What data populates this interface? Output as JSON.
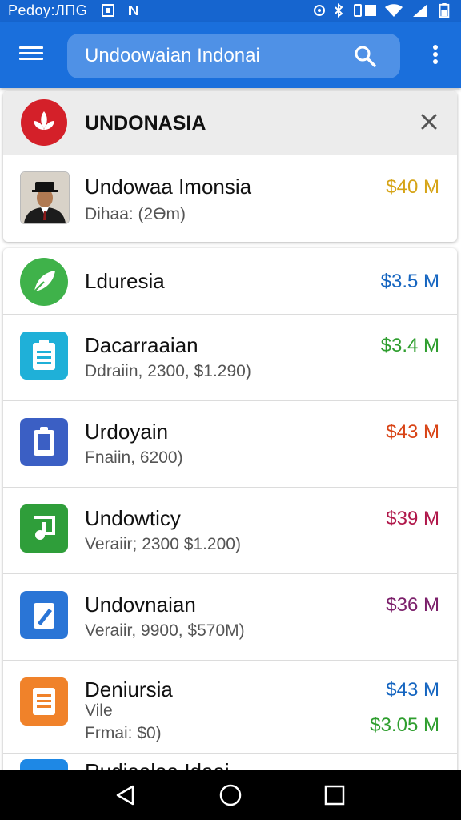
{
  "status_bar": {
    "time": "Pedoy:ЛПG"
  },
  "app_bar": {
    "search_text": "Undoowaian Indonai"
  },
  "featured": {
    "header_title": "UNDONASIA",
    "name": "Undowaa Imonsia",
    "subtitle": "Dihaa: (2Өm)",
    "price": "$40 M"
  },
  "items": [
    {
      "name": "Lduresia",
      "sub": "",
      "price": "$3.5 M",
      "price_color": "#1565c0",
      "icon": "leaf-icon",
      "icon_color": "#3fb24a"
    },
    {
      "name": "Dacarraaian",
      "sub": "Ddraiin, 2300, $1.290)",
      "price": "$3.4 M",
      "price_color": "#2e9e2e",
      "icon": "clipboard-icon",
      "icon_color": "#1fb0d8"
    },
    {
      "name": "Urdoyain",
      "sub": "Fnaiin, 6200)",
      "price": "$43 M",
      "price_color": "#d84315",
      "icon": "document-icon",
      "icon_color": "#3b5fc4"
    },
    {
      "name": "Undowticy",
      "sub": "Veraiir; 2300 $1.200)",
      "price": "$39 M",
      "price_color": "#b0174a",
      "icon": "music-icon",
      "icon_color": "#2f9e3a"
    },
    {
      "name": "Undovnaian",
      "sub": "Veraiir, 9900, $570M)",
      "price": "$36 M",
      "price_color": "#7b1f6a",
      "icon": "edit-icon",
      "icon_color": "#2a75d6"
    },
    {
      "name": "Deniursia",
      "sub": "Vile",
      "sub2": "Frmai: $0)",
      "price": "$43 M",
      "price_color": "#1565c0",
      "price2": "$3.05 M",
      "price2_color": "#2e9e2e",
      "icon": "notes-icon",
      "icon_color": "#f0822a"
    },
    {
      "name": "Rudjaalaa Idaai",
      "icon": "partial-icon",
      "icon_color": "#1e88e5"
    }
  ]
}
